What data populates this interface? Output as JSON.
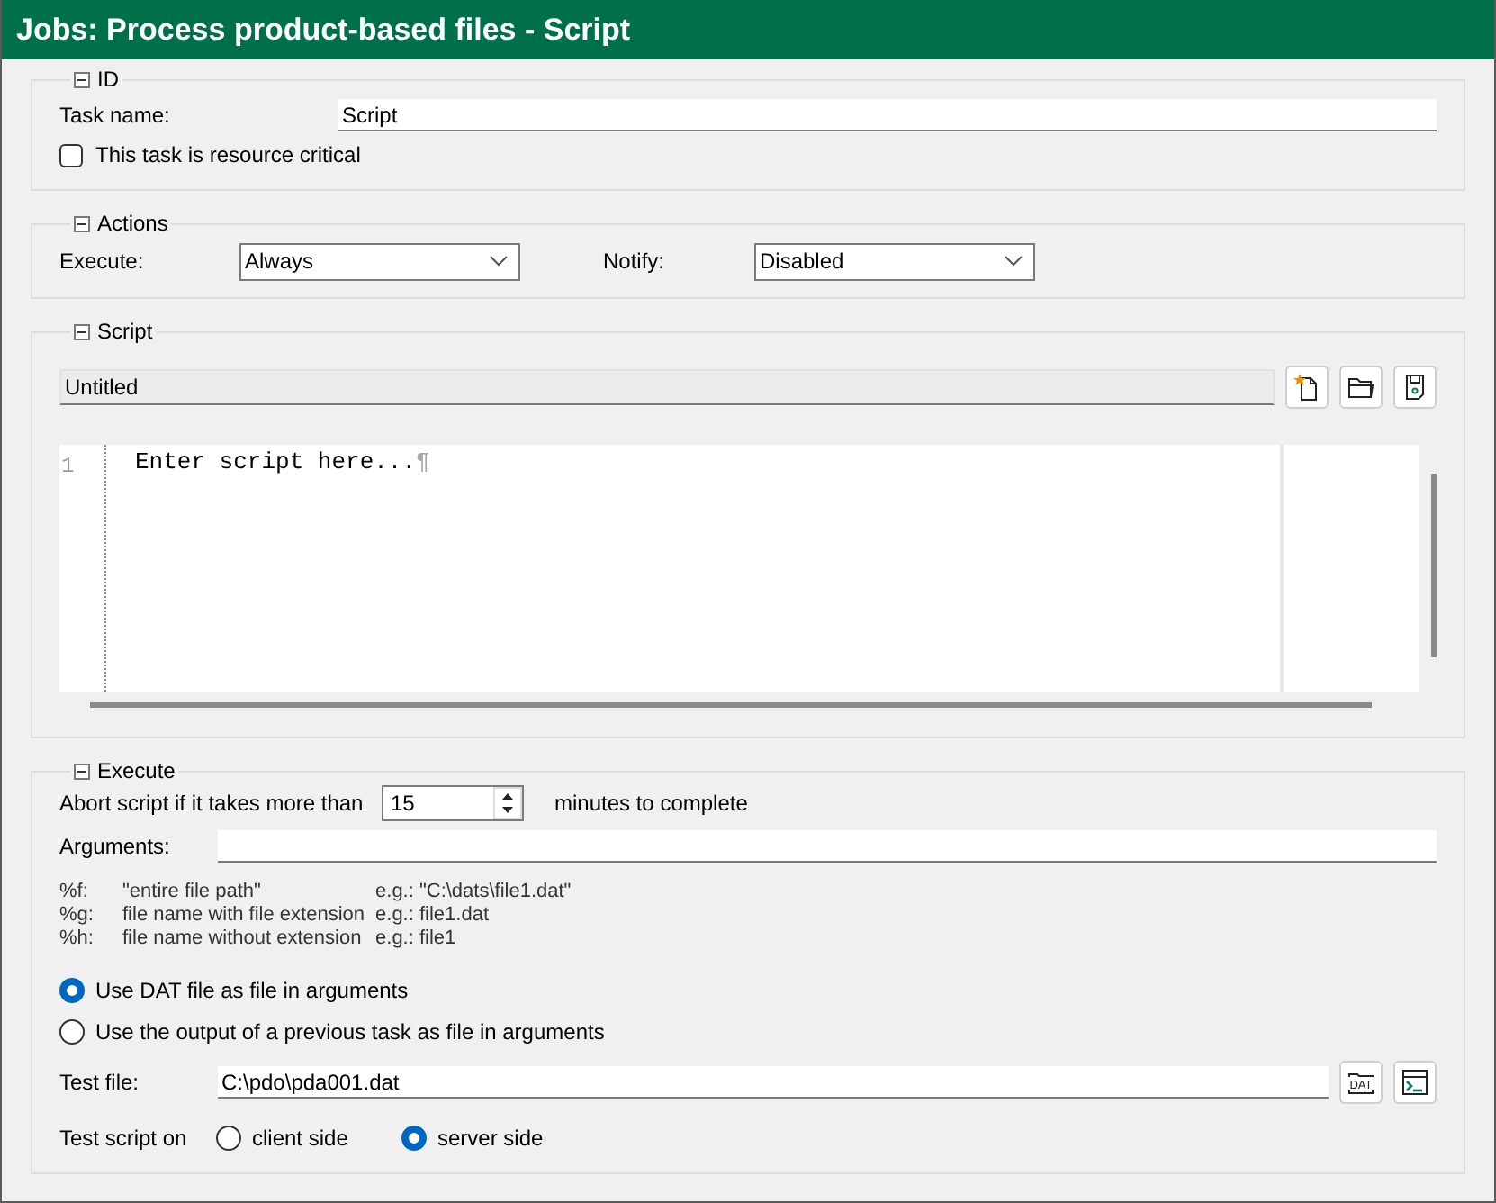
{
  "window": {
    "title": "Jobs: Process product-based files - Script"
  },
  "id_section": {
    "title": "ID",
    "expanded": true,
    "task_name_label": "Task name:",
    "task_name_value": "Script",
    "resource_critical": {
      "label": "This task is resource critical",
      "checked": false
    }
  },
  "actions_section": {
    "title": "Actions",
    "expanded": true,
    "execute_label": "Execute:",
    "execute_value": "Always",
    "notify_label": "Notify:",
    "notify_value": "Disabled"
  },
  "script_section": {
    "title": "Script",
    "expanded": true,
    "file_name": "Untitled",
    "lines": [
      {
        "number": "1",
        "text": "Enter script here...",
        "end_mark": "¶"
      }
    ]
  },
  "execute_section": {
    "title": "Execute",
    "expanded": true,
    "abort_label": "Abort script if it takes more than",
    "abort_minutes": "15",
    "abort_suffix": "minutes to complete",
    "arguments_label": "Arguments:",
    "legend": [
      {
        "code": "%f:",
        "description": "\"entire file path\"",
        "example": "e.g.: \"C:\\dats\\file1.dat\""
      },
      {
        "code": "%g:",
        "description": "file name with file extension",
        "example": "e.g.: file1.dat"
      },
      {
        "code": "%h:",
        "description": "file name without extension",
        "example": "e.g.: file1"
      }
    ],
    "source_options": [
      {
        "label": "Use DAT file as file in arguments",
        "selected": true
      },
      {
        "label": "Use the output of a previous task as file in arguments",
        "selected": false
      }
    ],
    "test_file_label": "Test file:",
    "test_file_value": "C:\\pdo\\pda001.dat",
    "dat_icon_text": "DAT",
    "test_on_label": "Test script on",
    "test_on_options": [
      {
        "label": "client side",
        "selected": false
      },
      {
        "label": "server side",
        "selected": true
      }
    ]
  }
}
